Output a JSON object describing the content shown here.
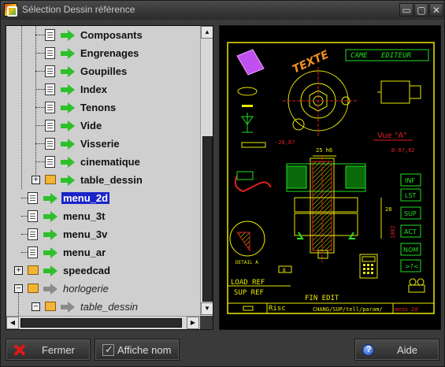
{
  "window": {
    "title": "Sélection Dessin référence",
    "buttons": {
      "minimize": "▭",
      "maximize": "▢",
      "close": "✕"
    }
  },
  "tree": {
    "items": [
      {
        "label": "Composants",
        "icon": "doc-green-arrow"
      },
      {
        "label": "Engrenages",
        "icon": "doc-green-arrow"
      },
      {
        "label": "Goupilles",
        "icon": "doc-green-arrow"
      },
      {
        "label": "Index",
        "icon": "doc-green-arrow"
      },
      {
        "label": "Tenons",
        "icon": "doc-green-arrow"
      },
      {
        "label": "Vide",
        "icon": "doc-green-arrow"
      },
      {
        "label": "Visserie",
        "icon": "doc-green-arrow"
      },
      {
        "label": "cinematique",
        "icon": "doc-green-arrow"
      },
      {
        "label": "table_dessin",
        "icon": "folder-green-arrow",
        "expander": "+"
      },
      {
        "label": "menu_2d",
        "icon": "doc-green-arrow",
        "selected": true
      },
      {
        "label": "menu_3t",
        "icon": "doc-green-arrow"
      },
      {
        "label": "menu_3v",
        "icon": "doc-green-arrow"
      },
      {
        "label": "menu_ar",
        "icon": "doc-green-arrow"
      },
      {
        "label": "speedcad",
        "icon": "folder-green-arrow",
        "expander": "+"
      },
      {
        "label": "horlogerie",
        "icon": "folder-grey-arrow",
        "expander": "−"
      },
      {
        "label": "table_dessin",
        "icon": "folder-grey-arrow",
        "expander": "−"
      }
    ]
  },
  "preview": {
    "drawing_texts": {
      "texte": "TEXTE",
      "came": "CAME",
      "editeur": "EDITEUR",
      "vue_a": "Vue \"A\"",
      "dim1": "-20,87",
      "dim2": "Ø 87,82",
      "dim3": "25 h6",
      "dim4": "28",
      "dim5": "1082",
      "detail": "DETAIL A",
      "b_label": "B",
      "load_ref": "LOAD REF",
      "sup_ref": "SUP REF",
      "fin_edit": "FIN EDIT",
      "risc": "Risc",
      "path": "CHANG/SUP/tell/param/",
      "path_menu": "menu_2d",
      "side_buttons": [
        "INF",
        "LST",
        "SUP",
        "ACT",
        "NOM",
        ">?<"
      ]
    }
  },
  "footer": {
    "close_label": "Fermer",
    "show_name_label": "Affiche nom",
    "help_label": "Aide"
  }
}
